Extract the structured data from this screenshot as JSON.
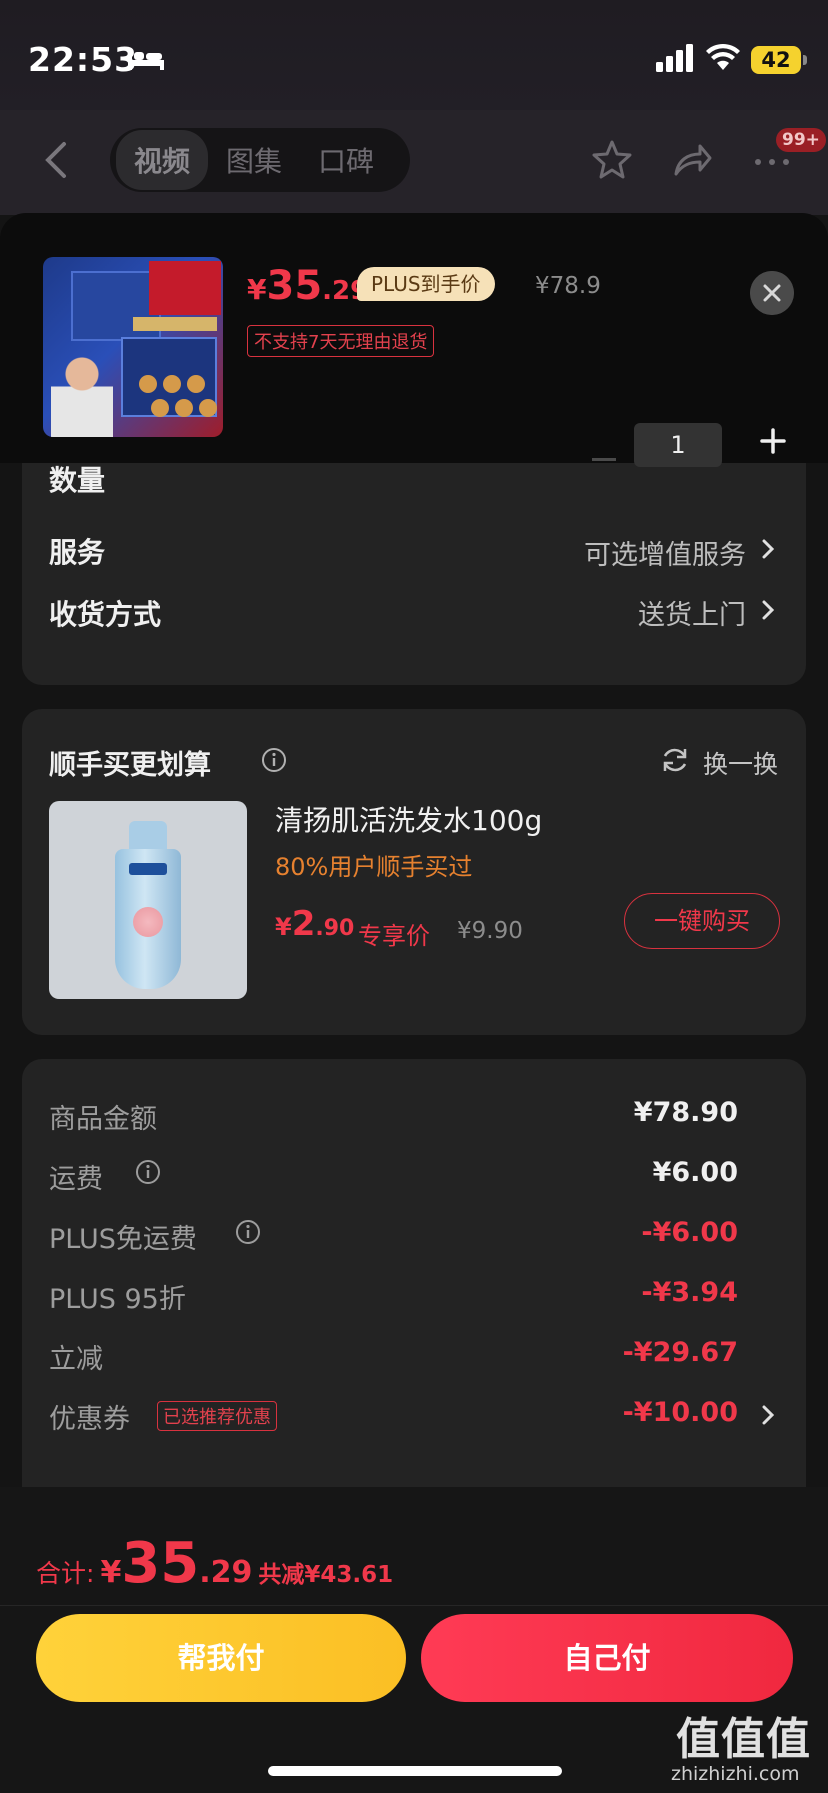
{
  "status_bar": {
    "time": "22:53",
    "battery": "42"
  },
  "top_nav": {
    "tabs": [
      {
        "label": "视频",
        "active": true
      },
      {
        "label": "图集"
      },
      {
        "label": "口碑"
      }
    ],
    "message_badge": "99+"
  },
  "product": {
    "price_currency": "¥",
    "price_int": "35",
    "price_dec": ".29",
    "plus_tag": "PLUS到手价",
    "original_price": "¥78.9",
    "no_return_notice": "不支持7天无理由退货"
  },
  "options": {
    "quantity_label": "数量",
    "quantity_value": "1",
    "service_label": "服务",
    "service_value": "可选增值服务",
    "delivery_label": "收货方式",
    "delivery_value": "送货上门"
  },
  "upsell": {
    "title": "顺手买更划算",
    "swap_label": "换一换",
    "item": {
      "name": "清扬肌活洗发水100g",
      "social_proof": "80%用户顺手买过",
      "price_currency": "¥",
      "price_int": "2",
      "price_dec": ".90",
      "price_tag": "专享价",
      "original_price": "¥9.90",
      "buy_label": "一键购买"
    }
  },
  "price_details": {
    "rows": [
      {
        "label": "商品金额",
        "value": "¥78.90"
      },
      {
        "label": "运费",
        "value": "¥6.00"
      },
      {
        "label": "PLUS免运费",
        "value": "-¥6.00"
      },
      {
        "label": "PLUS 95折",
        "value": "-¥3.94"
      },
      {
        "label": "立减",
        "value": "-¥29.67"
      },
      {
        "label": "优惠券",
        "value": "-¥10.00",
        "tag": "已选推荐优惠"
      }
    ]
  },
  "checkout": {
    "total_label": "合计:",
    "total_currency": "¥",
    "total_int": "35",
    "total_dec": ".29",
    "saved_text": "共减¥43.61",
    "helper_pay_label": "帮我付",
    "self_pay_label": "自己付"
  },
  "watermark": {
    "text": "值值值",
    "url": "zhizhizhi.com"
  },
  "colors": {
    "accent_red": "#f0384a",
    "helper_yellow": "#ffd23a",
    "card_bg": "#232323"
  }
}
